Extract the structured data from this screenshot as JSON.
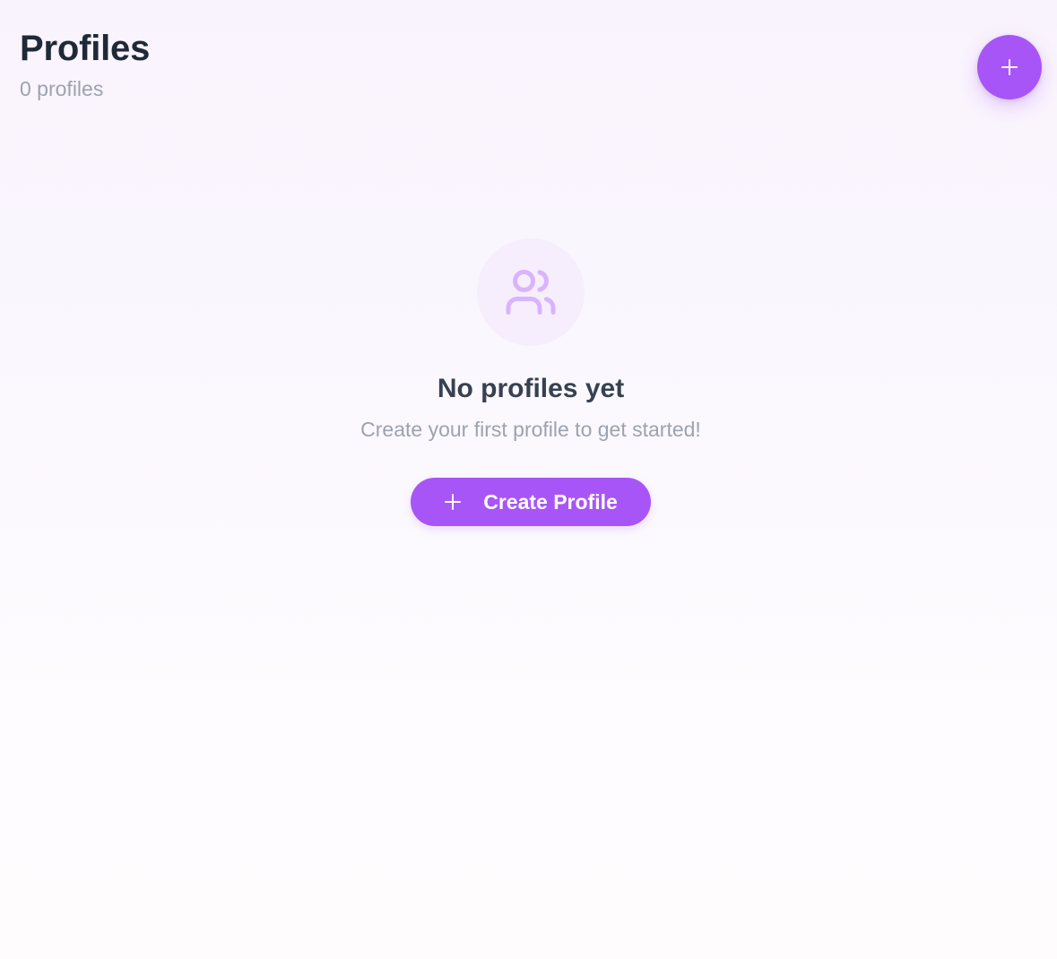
{
  "header": {
    "title": "Profiles",
    "count_text": "0 profiles"
  },
  "fab": {
    "icon": "plus-icon"
  },
  "empty_state": {
    "icon": "users-icon",
    "title": "No profiles yet",
    "subtitle": "Create your first profile to get started!",
    "button_label": "Create Profile",
    "button_icon": "plus-icon"
  },
  "colors": {
    "accent": "#a855f7",
    "icon_tint": "#d8b4fe",
    "icon_circle_bg": "#f6eefc",
    "title_text": "#1f2937",
    "muted_text": "#9ca3af"
  }
}
